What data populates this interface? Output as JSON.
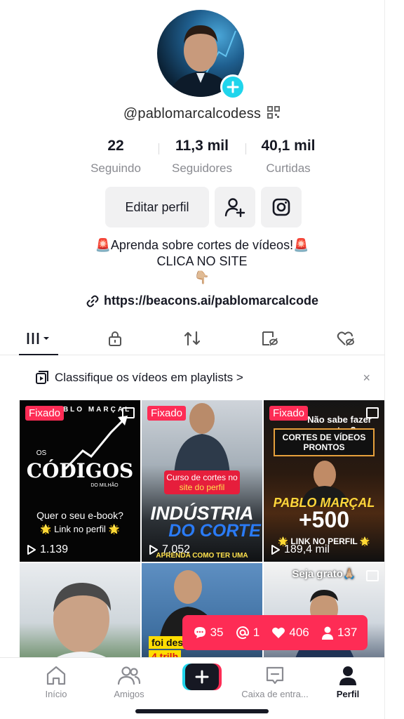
{
  "profile": {
    "username": "@pablomarcalcodess",
    "stats": [
      {
        "value": "22",
        "label": "Seguindo"
      },
      {
        "value": "11,3 mil",
        "label": "Seguidores"
      },
      {
        "value": "40,1 mil",
        "label": "Curtidas"
      }
    ],
    "edit_label": "Editar perfil",
    "bio_line1": "🚨Aprenda sobre cortes de vídeos!🚨",
    "bio_line2": "CLICA NO SITE",
    "bio_line3": "👇🏼",
    "link": "https://beacons.ai/pablomarcalcode"
  },
  "playlist_bar": {
    "text": "Classifique os vídeos em playlists >",
    "close": "×"
  },
  "videos": [
    {
      "pinned": "Fixado",
      "views": "1.139",
      "texts": [
        "PABLO MARÇAL",
        "OS",
        "CÓDIGOS",
        "DO MILHÃO",
        "Quer o seu e-book?",
        "🌟 Link no perfil 🌟"
      ]
    },
    {
      "pinned": "Fixado",
      "views": "7.052",
      "texts": [
        "Curso de cortes no",
        "site do perfil",
        "INDÚSTRIA",
        "DO CORTE",
        "APRENDA COMO TER UMA"
      ]
    },
    {
      "pinned": "Fixado",
      "views": "189,4 mil",
      "texts": [
        "Não sabe fazer cortes?",
        "CORTES DE VÍDEOS PRONTOS",
        "PABLO MARÇAL",
        "+500",
        "🌟 LINK NO PERFIL 🌟"
      ]
    },
    {
      "texts": []
    },
    {
      "texts": [
        "foi des",
        "4 trilh"
      ]
    },
    {
      "texts": [
        "Seja grato🙏🏼"
      ]
    }
  ],
  "notification": {
    "comments": "35",
    "mentions": "1",
    "likes": "406",
    "followers": "137"
  },
  "nav": {
    "home": "Início",
    "friends": "Amigos",
    "inbox": "Caixa de entra...",
    "profile": "Perfil"
  },
  "colors": {
    "accent": "#fe2c55",
    "badge": "#20d5ec",
    "text": "#161823",
    "muted": "#8a8b91"
  }
}
